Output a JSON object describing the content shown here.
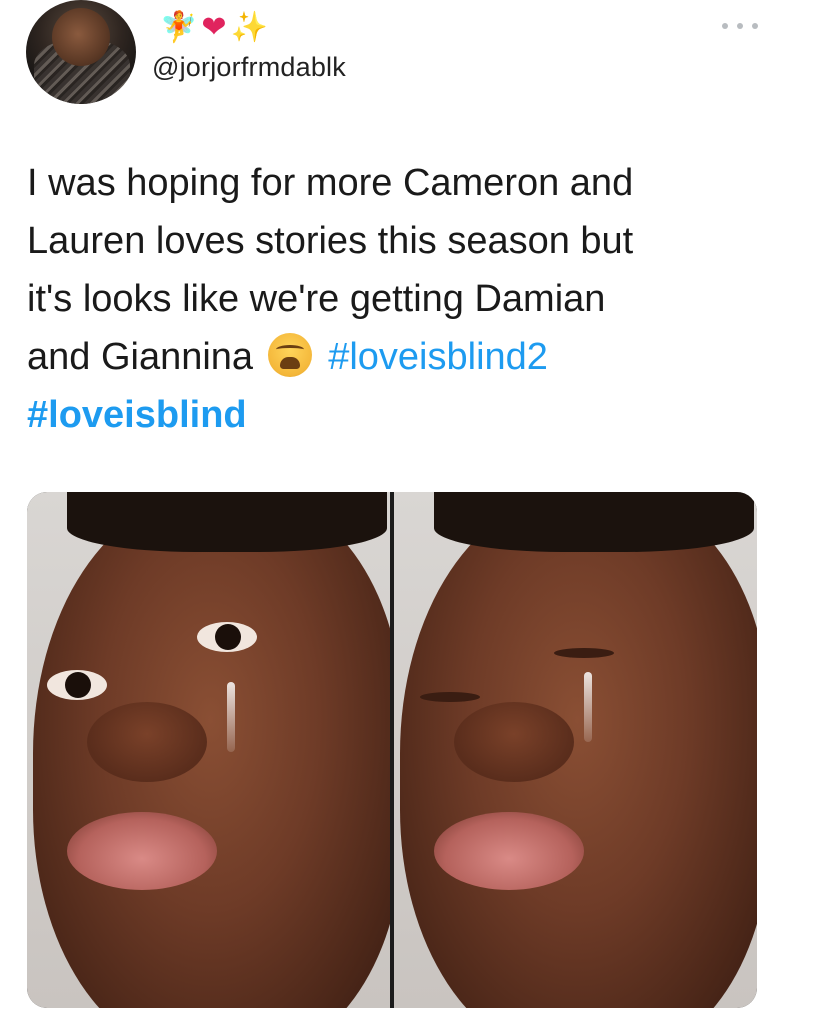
{
  "tweet": {
    "display_name_emojis": {
      "fairy": "🧚",
      "heart": "❤",
      "sparkles": "✨"
    },
    "handle": "@jorjorfrmdablk",
    "more_icon": "more-horizontal-icon",
    "text": {
      "line1": "I was hoping for more Cameron and",
      "line2": "Lauren loves stories this season but",
      "line3": "it's looks like we're getting Damian",
      "line4_prefix": "and Giannina",
      "emoji": "weary-face-icon",
      "hashtag1": "#loveisblind2",
      "hashtag2": "#loveisblind"
    },
    "colors": {
      "hashtag": "#1d9bf0",
      "text": "#1a1a1a"
    },
    "media": {
      "description_icon": "crying-man-meme-image"
    }
  }
}
